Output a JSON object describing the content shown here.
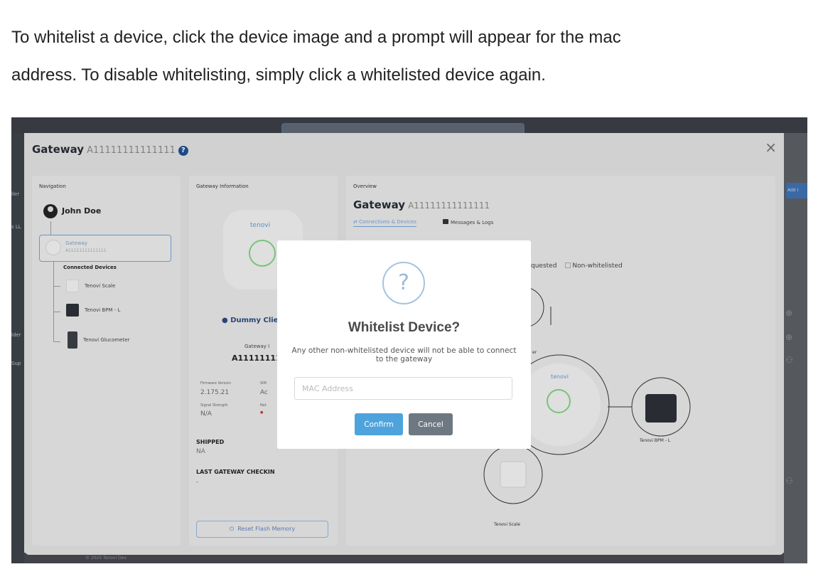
{
  "intro": {
    "line1": "To whitelist a device, click the device image and a prompt will appear for the mac",
    "line2": "address. To disable whitelisting, simply click a whitelisted device again."
  },
  "background": {
    "left_labels": [
      "ller",
      "s LL",
      "lder",
      "Sup"
    ],
    "add_label": "Add I",
    "footer": "© 2025 Tenovi Dev"
  },
  "modal": {
    "title": "Gateway",
    "gateway_id": "A11111111111111",
    "close_glyph": "×",
    "help_glyph": "?"
  },
  "navigation": {
    "header": "Navigation",
    "user": "John Doe",
    "gateway_label": "Gateway",
    "gateway_id": "A11111111111111",
    "connected_devices_label": "Connected Devices",
    "devices": [
      "Tenovi Scale",
      "Tenovi BPM - L",
      "Tenovi Glucometer"
    ]
  },
  "gateway_info": {
    "header": "Gateway Information",
    "brand": "tenovi",
    "client": "Dummy Clie",
    "gateway_label": "Gateway I",
    "gateway_id": "A1111111111",
    "firmware_label": "Firmware Version",
    "firmware_value": "2.175.21",
    "sim_label": "SIM",
    "sim_value": "Ac",
    "signal_label": "Signal Strength",
    "signal_value": "N/A",
    "net_label": "Net",
    "shipped_label": "SHIPPED",
    "shipped_value": "NA",
    "last_checkin_label": "LAST GATEWAY CHECKIN",
    "last_checkin_value": "-",
    "reset_button": "Reset Flash Memory"
  },
  "overview": {
    "header": "Overview",
    "title": "Gateway",
    "gateway_id": "A11111111111111",
    "tab_connections": "Connections & Devices",
    "tab_messages": "Messages & Logs",
    "legend_requested": "quested",
    "legend_non_whitelisted": "Non-whitelisted",
    "brand": "tenovi",
    "device_bpm": "Tenovi BPM - L",
    "device_scale": "Tenovi Scale",
    "partial_label": "er"
  },
  "dialog": {
    "icon_glyph": "?",
    "title": "Whitelist Device?",
    "text": "Any other non-whitelisted device will not be able to connect to the gateway",
    "mac_placeholder": "MAC Address",
    "mac_value": "",
    "confirm": "Confirm",
    "cancel": "Cancel"
  },
  "colors": {
    "accent": "#4fa3dc",
    "cancel": "#6e7882",
    "ring_green": "#7fcf7f",
    "brand_blue": "#5a9bd5"
  }
}
